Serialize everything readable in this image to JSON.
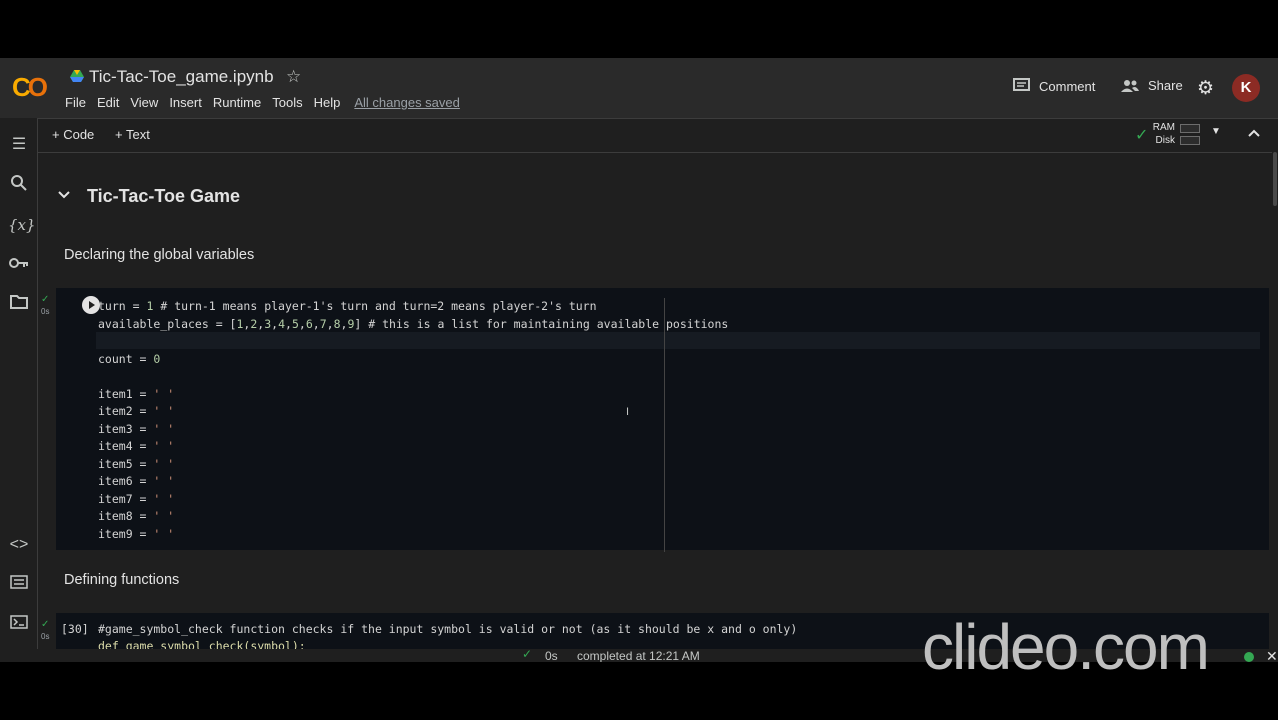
{
  "header": {
    "title": "Tic-Tac-Toe_game.ipynb",
    "menu": [
      "File",
      "Edit",
      "View",
      "Insert",
      "Runtime",
      "Tools",
      "Help"
    ],
    "saved_status": "All changes saved",
    "comment_label": "Comment",
    "share_label": "Share",
    "avatar_letter": "K"
  },
  "toolbar": {
    "add_code": "+ Code",
    "add_text": "+ Text",
    "ram_label": "RAM",
    "disk_label": "Disk"
  },
  "notebook": {
    "section_title": "Tic-Tac-Toe Game",
    "text1": "Declaring the global variables",
    "cell1_exec_time": "0s",
    "text2": "Defining functions",
    "cell2_exec_count": "[30]",
    "cell2_exec_time": "0s",
    "cell2_line1": "#game_symbol_check function checks if the input symbol is valid or not (as it should be x and o only)",
    "cell2_line2": "def game_symbol_check(symbol):"
  },
  "status_bar": {
    "time": "0s",
    "completed": "completed at 12:21 AM"
  },
  "watermark": "clideo.com",
  "colors": {
    "logo_yellow": "#f9ab00",
    "logo_orange": "#e8710a",
    "avatar": "#8c2b24",
    "check_green": "#34a853"
  }
}
